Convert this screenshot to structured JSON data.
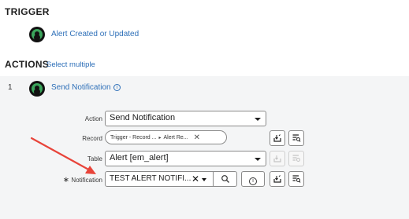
{
  "trigger": {
    "heading": "TRIGGER",
    "link": "Alert Created or Updated",
    "icon": "flow-trigger-icon"
  },
  "actions": {
    "heading": "ACTIONS",
    "select_multiple": "Select multiple",
    "items": [
      {
        "index": "1",
        "title": "Send Notification",
        "icon": "flow-action-icon",
        "fields": {
          "action": {
            "label": "Action",
            "value": "Send Notification"
          },
          "record": {
            "label": "Record",
            "pill_part1": "Trigger - Record ...",
            "pill_sep": "▸",
            "pill_part2": "Alert Re...",
            "close": "✕"
          },
          "table": {
            "label": "Table",
            "value": "Alert [em_alert]"
          },
          "notification": {
            "label": "Notification",
            "required": "∗",
            "value": "TEST ALERT NOTIFI...",
            "clear": "✕"
          }
        }
      }
    ]
  },
  "annotation": {
    "arrow_color": "#e8443a",
    "points_to": "notification"
  },
  "colors": {
    "link": "#2d6fb8",
    "panel_bg": "#f4f5f6",
    "icon_green": "#3ba55c"
  }
}
